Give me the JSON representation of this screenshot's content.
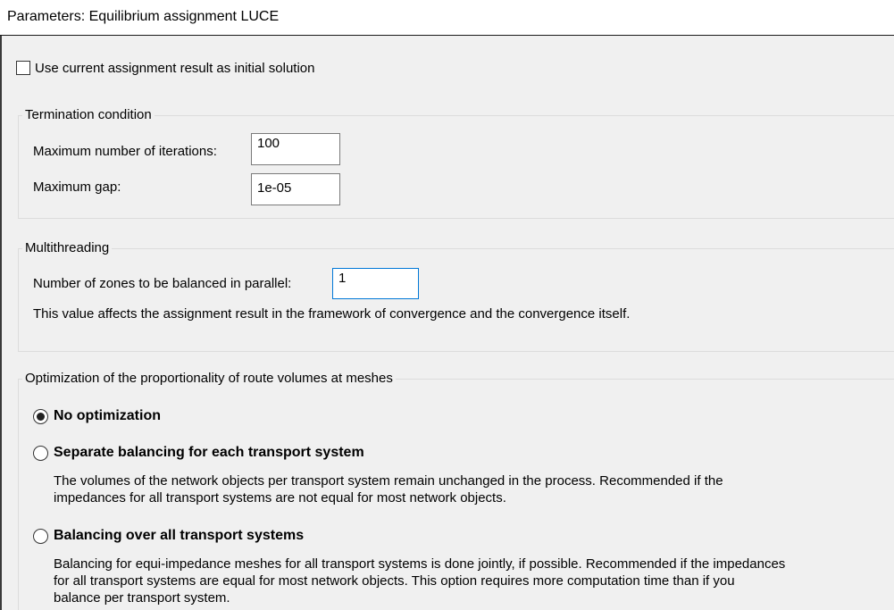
{
  "window": {
    "title": "Parameters: Equilibrium assignment LUCE"
  },
  "initial_solution": {
    "label": "Use current assignment result as initial solution",
    "checked": false
  },
  "termination": {
    "legend": "Termination condition",
    "max_iterations_label": "Maximum number of iterations:",
    "max_iterations_value": "100",
    "max_gap_label": "Maximum gap:",
    "max_gap_value": "1e-05"
  },
  "multithreading": {
    "legend": "Multithreading",
    "zones_label": "Number of zones to be balanced in parallel:",
    "zones_value": "1",
    "note": "This value affects the assignment result in the framework of convergence and the convergence itself."
  },
  "optimization": {
    "legend": "Optimization of the proportionality of route volumes at meshes",
    "options": [
      {
        "label": "No optimization",
        "selected": true,
        "description": ""
      },
      {
        "label": "Separate balancing for each transport system",
        "selected": false,
        "description_lines": [
          "The volumes of the network objects per transport system remain unchanged in the process. Recommended if the",
          "impedances for all transport systems are not equal for most network objects."
        ]
      },
      {
        "label": "Balancing over all transport systems",
        "selected": false,
        "description_lines": [
          "Balancing for equi-impedance meshes for all transport systems is done jointly, if possible. Recommended if the impedances",
          "for all transport systems are equal for most network objects. This option requires more computation time than if you",
          "balance per transport system."
        ]
      }
    ]
  }
}
